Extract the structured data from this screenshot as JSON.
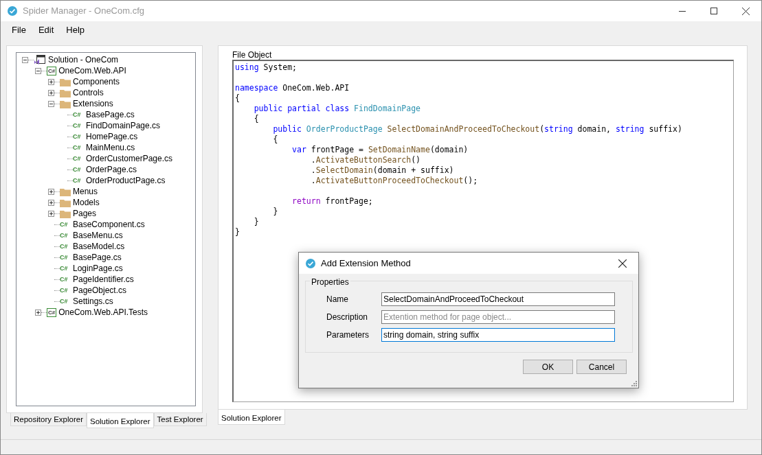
{
  "window": {
    "title": "Spider Manager - OneCom.cfg"
  },
  "menu": [
    "File",
    "Edit",
    "Help"
  ],
  "tree": [
    {
      "label": "Solution - OneCom",
      "kind": "solution",
      "expanded": true,
      "children": [
        {
          "label": "OneCom.Web.API",
          "kind": "project",
          "badge": "C#",
          "expanded": true,
          "children": [
            {
              "label": "Components",
              "kind": "folder",
              "expanded": false
            },
            {
              "label": "Controls",
              "kind": "folder",
              "expanded": false
            },
            {
              "label": "Extensions",
              "kind": "folder",
              "expanded": true,
              "children": [
                {
                  "label": "BasePage.cs",
                  "kind": "file",
                  "badge": "C#"
                },
                {
                  "label": "FindDomainPage.cs",
                  "kind": "file",
                  "badge": "C#"
                },
                {
                  "label": "HomePage.cs",
                  "kind": "file",
                  "badge": "C#"
                },
                {
                  "label": "MainMenu.cs",
                  "kind": "file",
                  "badge": "C#"
                },
                {
                  "label": "OrderCustomerPage.cs",
                  "kind": "file",
                  "badge": "C#"
                },
                {
                  "label": "OrderPage.cs",
                  "kind": "file",
                  "badge": "C#"
                },
                {
                  "label": "OrderProductPage.cs",
                  "kind": "file",
                  "badge": "C#"
                }
              ]
            },
            {
              "label": "Menus",
              "kind": "folder",
              "expanded": false
            },
            {
              "label": "Models",
              "kind": "folder",
              "expanded": false
            },
            {
              "label": "Pages",
              "kind": "folder",
              "expanded": false
            },
            {
              "label": "BaseComponent.cs",
              "kind": "file",
              "badge": "C#"
            },
            {
              "label": "BaseMenu.cs",
              "kind": "file",
              "badge": "C#"
            },
            {
              "label": "BaseModel.cs",
              "kind": "file",
              "badge": "C#"
            },
            {
              "label": "BasePage.cs",
              "kind": "file",
              "badge": "C#"
            },
            {
              "label": "LoginPage.cs",
              "kind": "file",
              "badge": "C#"
            },
            {
              "label": "PageIdentifier.cs",
              "kind": "file",
              "badge": "C#"
            },
            {
              "label": "PageObject.cs",
              "kind": "file",
              "badge": "C#"
            },
            {
              "label": "Settings.cs",
              "kind": "file",
              "badge": "C#"
            }
          ]
        },
        {
          "label": "OneCom.Web.API.Tests",
          "kind": "project",
          "badge": "C#",
          "expanded": false
        }
      ]
    }
  ],
  "left_tabs": [
    {
      "label": "Repository Explorer",
      "selected": false
    },
    {
      "label": "Solution Explorer",
      "selected": true
    },
    {
      "label": "Test Explorer",
      "selected": false
    }
  ],
  "editor": {
    "group_title": "File Object",
    "lines": [
      {
        "kind": "code",
        "tokens": [
          {
            "kind": "keyword",
            "text": "using"
          },
          {
            "kind": "plain",
            "text": " System;"
          }
        ]
      },
      {
        "kind": "blank"
      },
      {
        "kind": "code",
        "tokens": [
          {
            "kind": "keyword",
            "text": "namespace"
          },
          {
            "kind": "plain",
            "text": " OneCom.Web.API"
          }
        ]
      },
      {
        "kind": "code",
        "tokens": [
          {
            "kind": "plain",
            "text": "{"
          }
        ]
      },
      {
        "kind": "code",
        "tokens": [
          {
            "kind": "keyword",
            "text": "    public partial class "
          },
          {
            "kind": "type",
            "text": "FindDomainPage"
          }
        ]
      },
      {
        "kind": "code",
        "tokens": [
          {
            "kind": "plain",
            "text": "    {"
          }
        ]
      },
      {
        "kind": "code",
        "tokens": [
          {
            "kind": "keyword",
            "text": "        public "
          },
          {
            "kind": "type",
            "text": "OrderProductPage "
          },
          {
            "kind": "method",
            "text": "SelectDomainAndProceedToCheckout"
          },
          {
            "kind": "plain",
            "text": "("
          },
          {
            "kind": "keyword",
            "text": "string"
          },
          {
            "kind": "plain",
            "text": " domain, "
          },
          {
            "kind": "keyword",
            "text": "string"
          },
          {
            "kind": "plain",
            "text": " suffix)"
          }
        ]
      },
      {
        "kind": "code",
        "tokens": [
          {
            "kind": "plain",
            "text": "        {"
          }
        ]
      },
      {
        "kind": "code",
        "tokens": [
          {
            "kind": "keyword",
            "text": "            var"
          },
          {
            "kind": "plain",
            "text": " frontPage = "
          },
          {
            "kind": "method",
            "text": "SetDomainName"
          },
          {
            "kind": "plain",
            "text": "(domain)"
          }
        ]
      },
      {
        "kind": "code",
        "tokens": [
          {
            "kind": "plain",
            "text": "                ."
          },
          {
            "kind": "method",
            "text": "ActivateButtonSearch"
          },
          {
            "kind": "plain",
            "text": "()"
          }
        ]
      },
      {
        "kind": "code",
        "tokens": [
          {
            "kind": "plain",
            "text": "                ."
          },
          {
            "kind": "method",
            "text": "SelectDomain"
          },
          {
            "kind": "plain",
            "text": "(domain + suffix)"
          }
        ]
      },
      {
        "kind": "code",
        "tokens": [
          {
            "kind": "plain",
            "text": "                ."
          },
          {
            "kind": "method",
            "text": "ActivateButtonProceedToCheckout"
          },
          {
            "kind": "plain",
            "text": "();"
          }
        ]
      },
      {
        "kind": "blank"
      },
      {
        "kind": "code",
        "tokens": [
          {
            "kind": "control",
            "text": "            return"
          },
          {
            "kind": "plain",
            "text": " frontPage;"
          }
        ]
      },
      {
        "kind": "code",
        "tokens": [
          {
            "kind": "plain",
            "text": "        }"
          }
        ]
      },
      {
        "kind": "code",
        "tokens": [
          {
            "kind": "plain",
            "text": "    }"
          }
        ]
      },
      {
        "kind": "code",
        "tokens": [
          {
            "kind": "plain",
            "text": "}"
          }
        ]
      }
    ]
  },
  "right_tabs": [
    {
      "label": "Solution Explorer",
      "selected": true
    }
  ],
  "dialog": {
    "title": "Add Extension Method",
    "group_title": "Properties",
    "fields": [
      {
        "label": "Name",
        "value": "SelectDomainAndProceedToCheckout",
        "focused": false
      },
      {
        "label": "Description",
        "placeholder": "Extention method for page object...",
        "focused": false
      },
      {
        "label": "Parameters",
        "value": "string domain, string suffix",
        "focused": true
      }
    ],
    "buttons": [
      "OK",
      "Cancel"
    ]
  }
}
